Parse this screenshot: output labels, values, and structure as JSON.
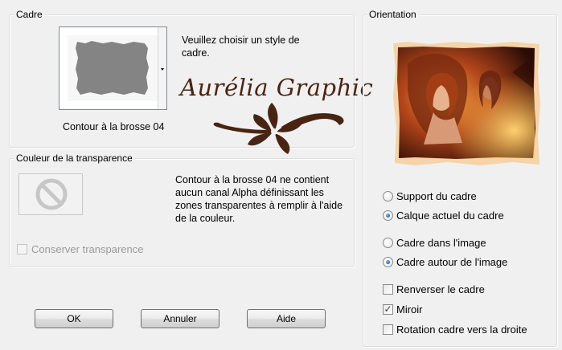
{
  "frame_group": {
    "legend": "Cadre",
    "instruction": "Veuillez choisir un style de cadre.",
    "selected_style": "Contour à la brosse 04"
  },
  "transparency_group": {
    "legend": "Couleur de la transparence",
    "description": "Contour à la brosse 04 ne contient aucun canal Alpha définissant les zones transparentes à remplir à l'aide de la couleur.",
    "keep_transparency_label": "Conserver transparence",
    "keep_transparency_checked": false
  },
  "watermark": {
    "text": "Aurélia Graphic"
  },
  "orientation_group": {
    "legend": "Orientation",
    "radio_group_1": [
      {
        "label": "Support du cadre",
        "selected": false
      },
      {
        "label": "Calque actuel du cadre",
        "selected": true
      }
    ],
    "radio_group_2": [
      {
        "label": "Cadre dans l'image",
        "selected": false
      },
      {
        "label": "Cadre autour de l'image",
        "selected": true
      }
    ],
    "checkboxes": [
      {
        "label": "Renverser le cadre",
        "checked": false
      },
      {
        "label": "Miroir",
        "checked": true
      },
      {
        "label": "Rotation cadre vers la droite",
        "checked": false
      }
    ]
  },
  "buttons": {
    "ok": "OK",
    "cancel": "Annuler",
    "help": "Aide"
  },
  "colors": {
    "dialog_bg": "#f0f0f0",
    "watermark_brown": "#4a2412",
    "radio_dot_blue": "#1a5aa8"
  }
}
